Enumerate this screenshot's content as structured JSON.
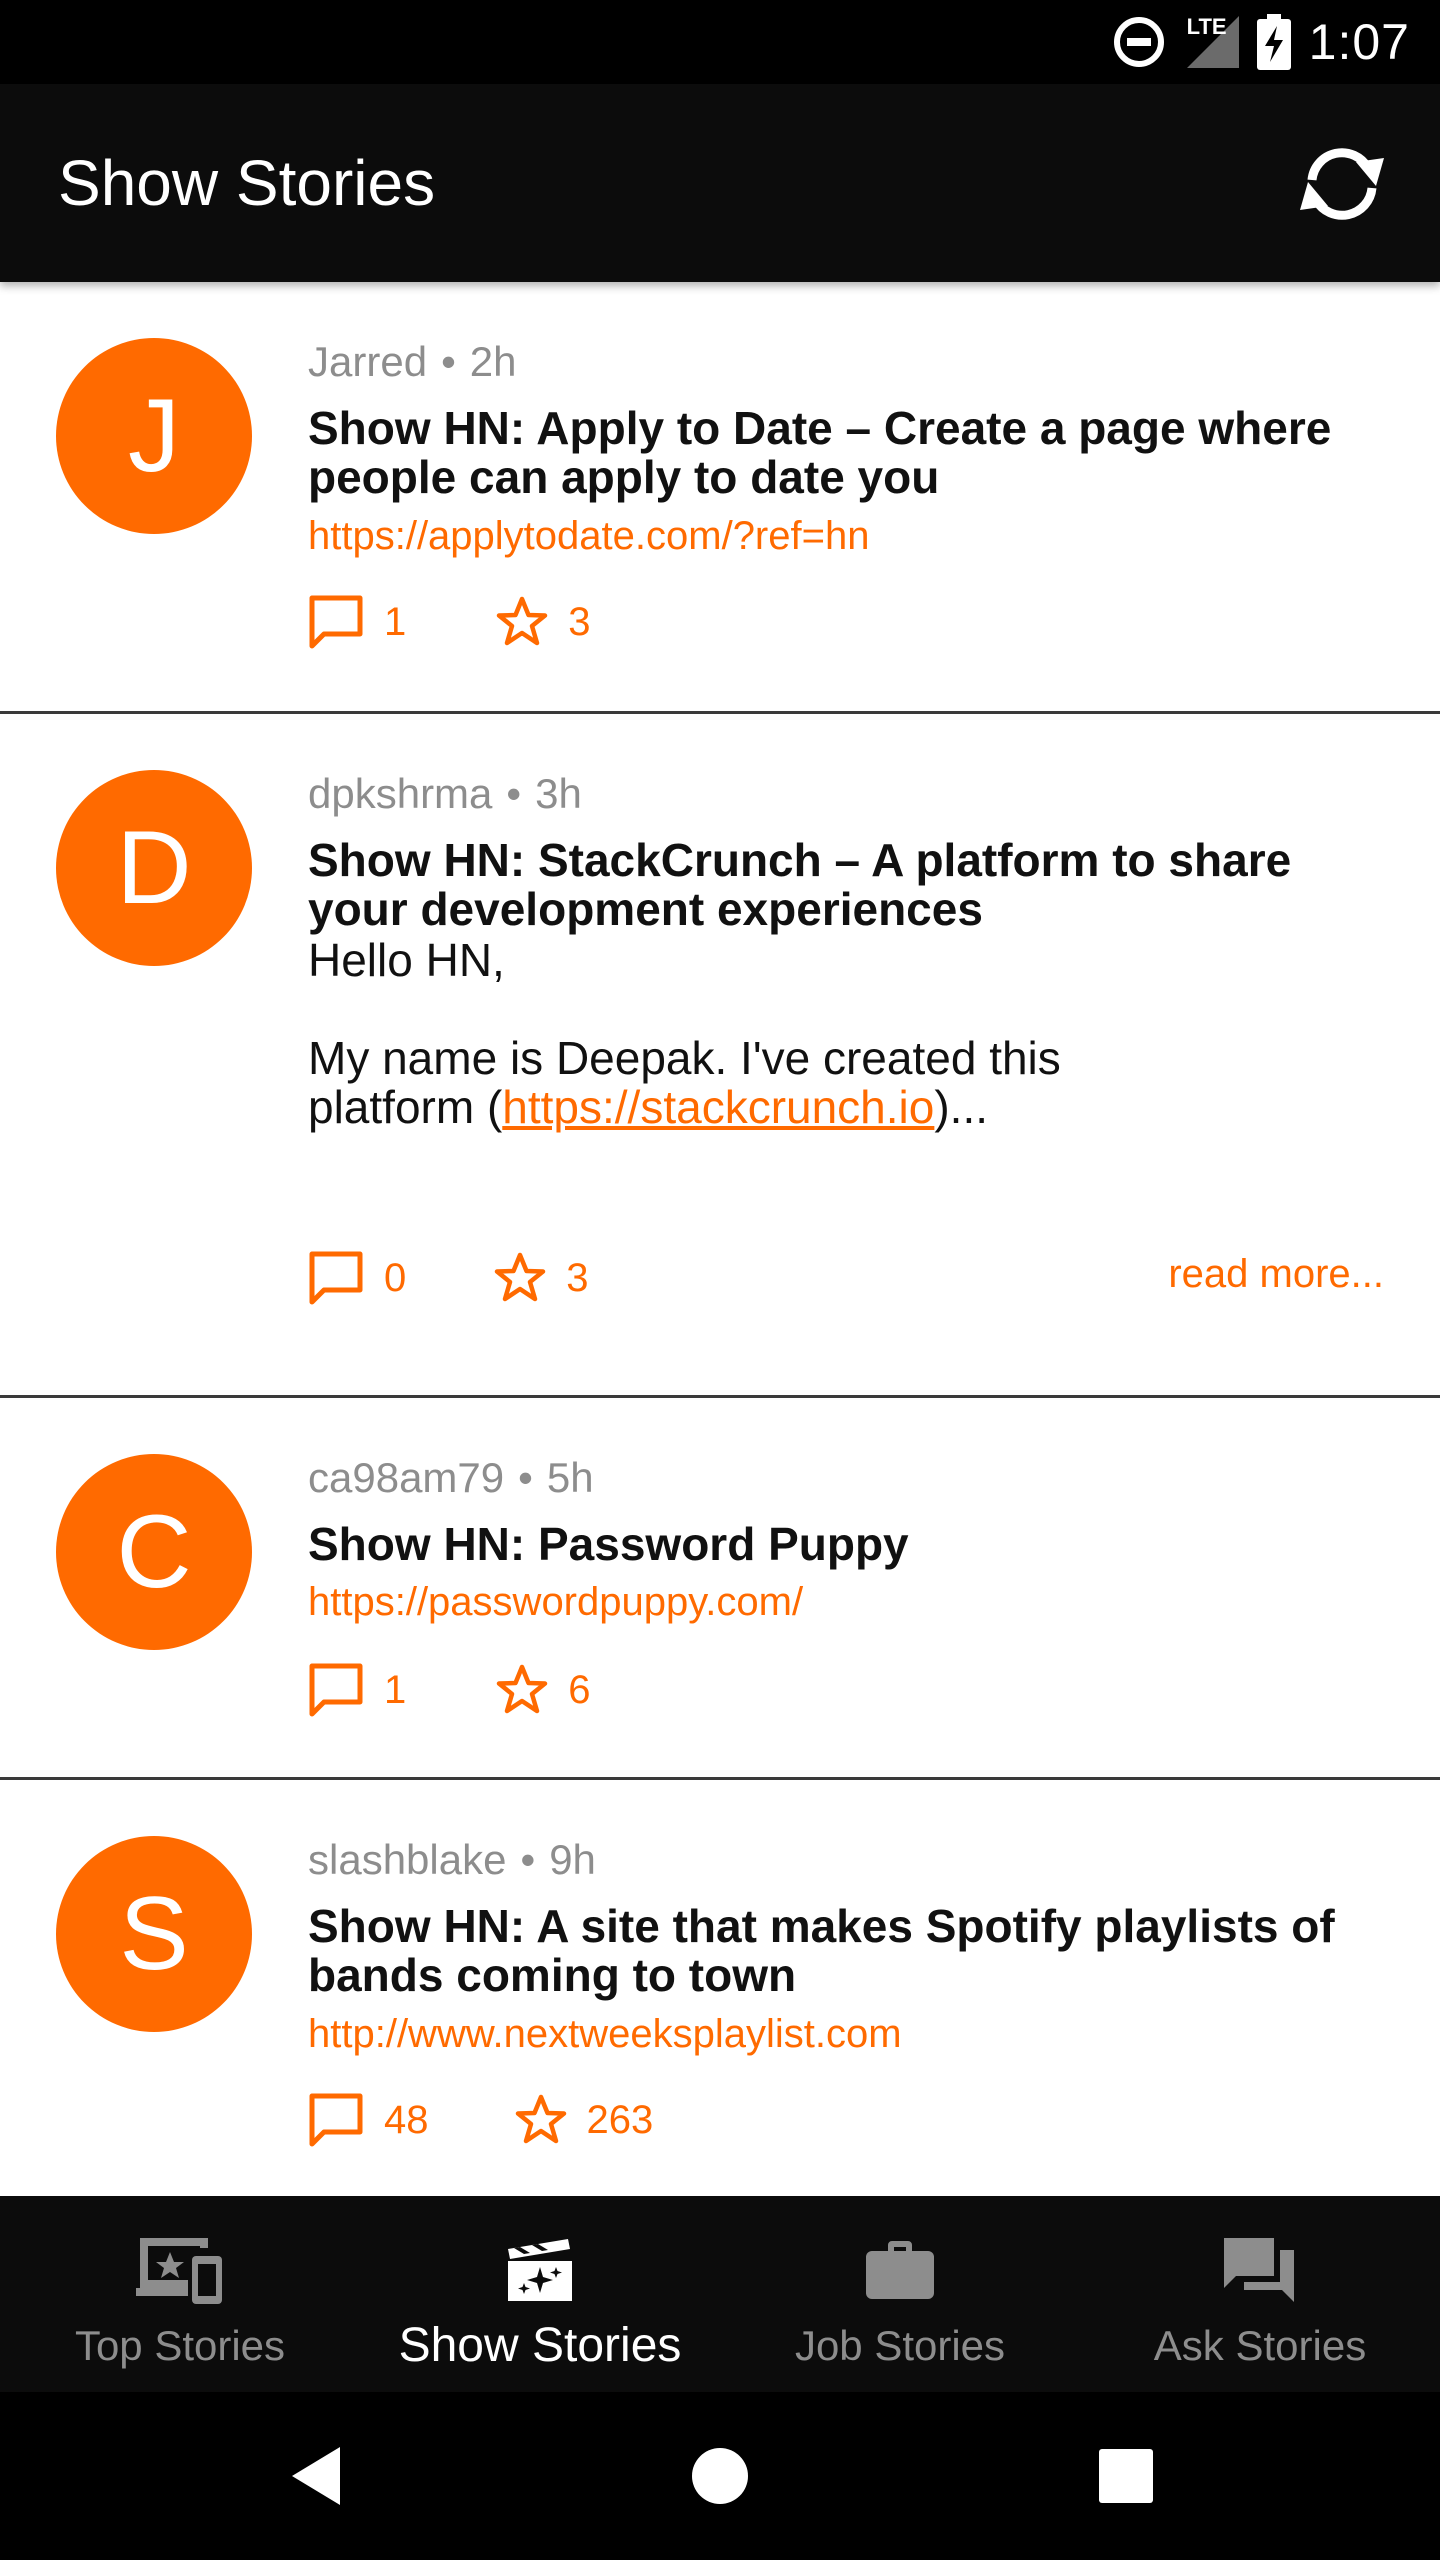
{
  "status_bar": {
    "time": "1:07",
    "network": "LTE"
  },
  "app_bar": {
    "title": "Show Stories"
  },
  "stories": [
    {
      "avatar_letter": "J",
      "author": "Jarred",
      "age": "2h",
      "title": "Show HN: Apply to Date – Create a page where people can apply to date you",
      "url": "https://applytodate.com/?ref=hn",
      "comments": "1",
      "stars": "3"
    },
    {
      "avatar_letter": "D",
      "author": "dpkshrma",
      "age": "3h",
      "title": "Show HN: StackCrunch – A platform to share your development experiences",
      "body_line1": "Hello HN,",
      "body_line2": "My name is Deepak. I've created this",
      "body_line3_prefix": "platform (",
      "body_link": "https://stackcrunch.io",
      "body_line3_suffix": ")...",
      "comments": "0",
      "stars": "3",
      "read_more": "read more..."
    },
    {
      "avatar_letter": "C",
      "author": "ca98am79",
      "age": "5h",
      "title": "Show HN: Password Puppy",
      "url": "https://passwordpuppy.com/",
      "comments": "1",
      "stars": "6"
    },
    {
      "avatar_letter": "S",
      "author": "slashblake",
      "age": "9h",
      "title": "Show HN: A site that makes Spotify playlists of bands coming to town",
      "url": "http://www.nextweeksplaylist.com",
      "comments": "48",
      "stars": "263"
    }
  ],
  "meta_separator": "•",
  "bottom_nav": [
    {
      "label": "Top Stories",
      "icon": "devices-star-icon",
      "active": false
    },
    {
      "label": "Show Stories",
      "icon": "movie-sparkle-icon",
      "active": true
    },
    {
      "label": "Job Stories",
      "icon": "briefcase-icon",
      "active": false
    },
    {
      "label": "Ask Stories",
      "icon": "forum-icon",
      "active": false
    }
  ],
  "colors": {
    "accent": "#ff6a00",
    "app_bar": "#0c0c0c",
    "muted": "#8d8d8d"
  }
}
